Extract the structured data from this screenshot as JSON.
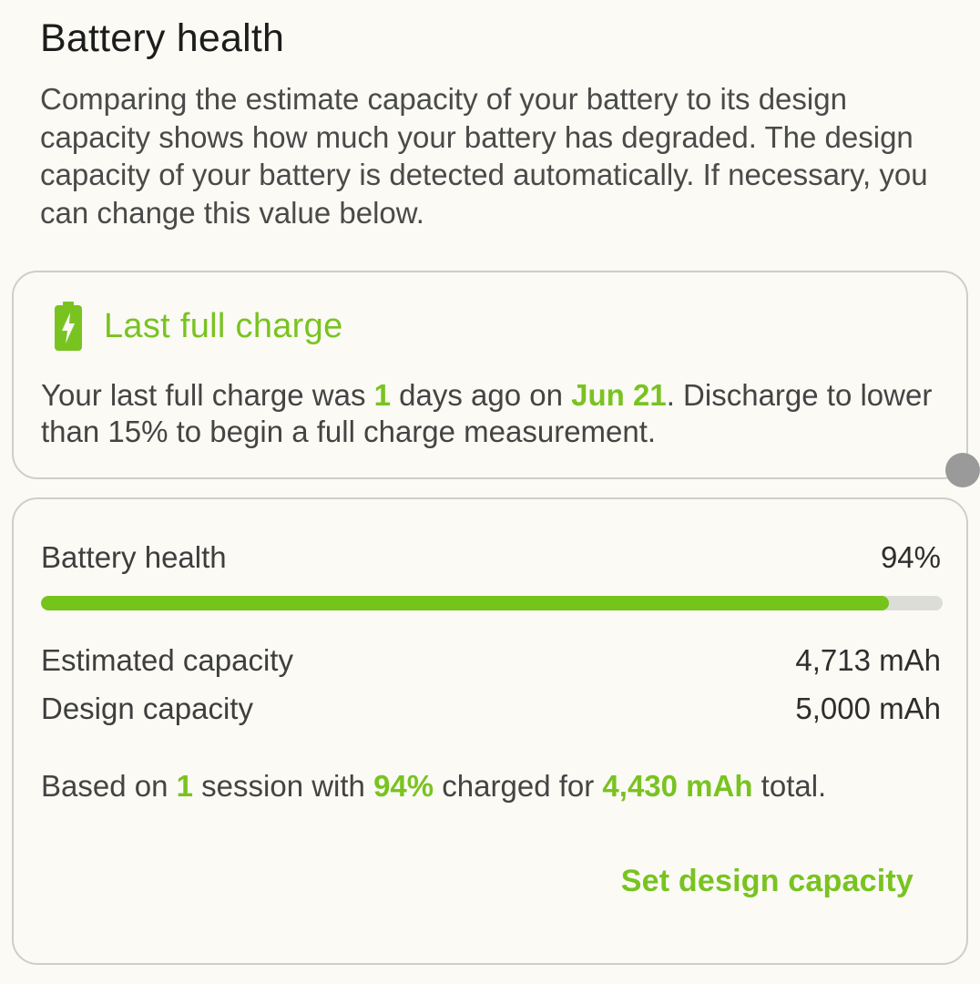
{
  "header": {
    "title": "Battery health",
    "description": "Comparing the estimate capacity of your battery to its design capacity shows how much your battery has degraded. The design capacity of your battery is detected automatically. If necessary, you can change this value below."
  },
  "last_charge": {
    "icon": "battery-charging-icon",
    "title": "Last full charge",
    "text_prefix": "Your last full charge was ",
    "days": "1",
    "text_mid": " days ago on ",
    "date": "Jun 21",
    "text_suffix": ". Discharge to lower than 15% to begin a full charge measurement."
  },
  "health": {
    "label": "Battery health",
    "value": "94%",
    "percent": 94,
    "estimated_label": "Estimated capacity",
    "estimated_value": "4,713 mAh",
    "design_label": "Design capacity",
    "design_value": "5,000 mAh",
    "summary_prefix": "Based on ",
    "sessions": "1",
    "summary_mid1": " session with ",
    "charged_percent": "94%",
    "summary_mid2": " charged for ",
    "charged_mah": "4,430 mAh",
    "summary_suffix": " total.",
    "set_button": "Set design capacity"
  },
  "colors": {
    "accent": "#79c321",
    "bar_fill": "#74c41b",
    "bar_track": "#dcdcd8",
    "background": "#fbfaf4"
  }
}
